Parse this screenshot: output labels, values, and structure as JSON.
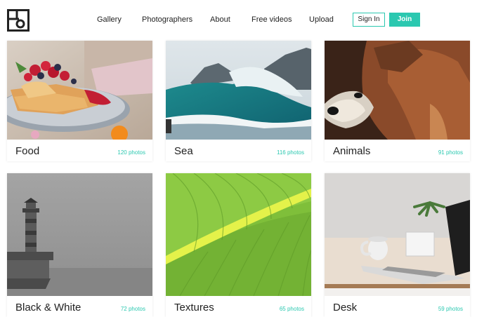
{
  "nav": {
    "gallery": "Gallery",
    "photographers": "Photographers",
    "about": "About",
    "free_videos": "Free videos",
    "upload": "Upload"
  },
  "auth": {
    "sign_in": "Sign In",
    "join": "Join"
  },
  "categories": [
    {
      "label": "Food",
      "count": "120 photos",
      "image": "food-photo"
    },
    {
      "label": "Sea",
      "count": "116 photos",
      "image": "sea-wave-photo"
    },
    {
      "label": "Animals",
      "count": "91 photos",
      "image": "dog-photo"
    },
    {
      "label": "Black & White",
      "count": "72 photos",
      "image": "lighthouse-photo"
    },
    {
      "label": "Textures",
      "count": "65 photos",
      "image": "leaf-texture-photo"
    },
    {
      "label": "Desk",
      "count": "59 photos",
      "image": "desk-laptop-photo"
    }
  ],
  "colors": {
    "accent": "#2bc8b0",
    "text": "#222222"
  },
  "icons": {
    "logo": "brand-logo-icon"
  }
}
